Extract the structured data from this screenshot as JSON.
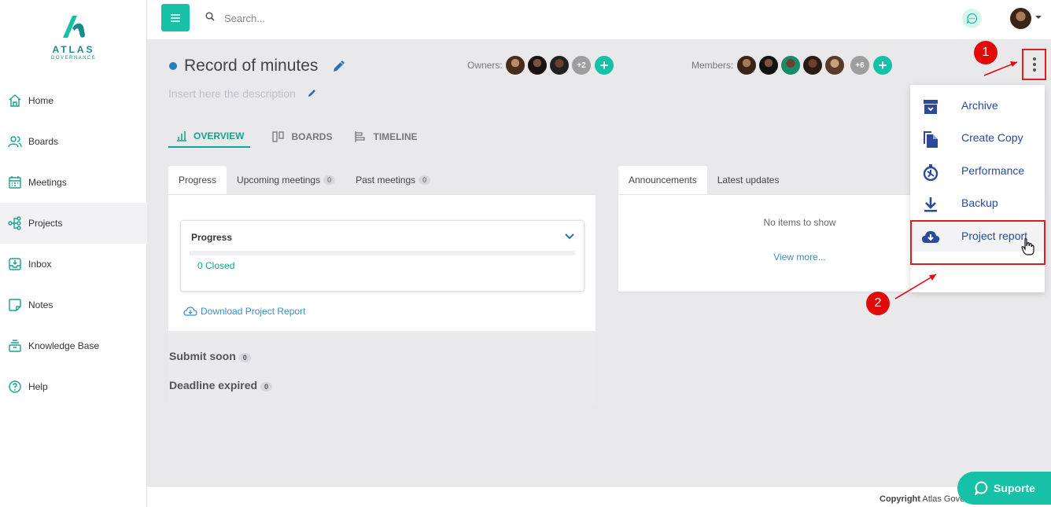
{
  "brand": {
    "name": "ATLAS",
    "tagline": "GOVERNANCE",
    "accent": "#17c1a8"
  },
  "sidebar": {
    "items": [
      {
        "label": "Home",
        "icon": "home-icon"
      },
      {
        "label": "Boards",
        "icon": "users-icon"
      },
      {
        "label": "Meetings",
        "icon": "calendar-icon"
      },
      {
        "label": "Projects",
        "icon": "project-tree-icon",
        "active": true
      },
      {
        "label": "Inbox",
        "icon": "inbox-icon"
      },
      {
        "label": "Notes",
        "icon": "note-icon"
      },
      {
        "label": "Knowledge Base",
        "icon": "layers-icon"
      },
      {
        "label": "Help",
        "icon": "help-circle-icon"
      }
    ]
  },
  "topbar": {
    "search_placeholder": "Search..."
  },
  "project": {
    "title": "Record of minutes",
    "description_placeholder": "Insert here the description",
    "owners_label": "Owners:",
    "owners_more": "+2",
    "members_label": "Members:",
    "members_more": "+6"
  },
  "view_tabs": {
    "overview": "OVERVIEW",
    "boards": "BOARDS",
    "timeline": "TIMELINE"
  },
  "left_panel": {
    "tabs": {
      "progress": "Progress",
      "upcoming": "Upcoming meetings",
      "upcoming_count": "0",
      "past": "Past meetings",
      "past_count": "0"
    },
    "card_title": "Progress",
    "closed_text": "0 Closed",
    "download_link": "Download Project Report",
    "submit_soon": "Submit soon",
    "submit_soon_count": "0",
    "deadline_expired": "Deadline expired",
    "deadline_expired_count": "0"
  },
  "right_panel": {
    "tabs": {
      "announcements": "Announcements",
      "latest": "Latest updates"
    },
    "empty_text": "No items to show",
    "view_more": "View more..."
  },
  "menu": {
    "items": [
      {
        "label": "Archive",
        "icon": "archive-icon"
      },
      {
        "label": "Create Copy",
        "icon": "copy-icon"
      },
      {
        "label": "Performance",
        "icon": "stopwatch-icon"
      },
      {
        "label": "Backup",
        "icon": "download-icon"
      },
      {
        "label": "Project report",
        "icon": "cloud-download-icon"
      }
    ]
  },
  "annotations": {
    "step1": "1",
    "step2": "2"
  },
  "footer": {
    "copyright_bold": "Copyright",
    "copyright_rest": " Atlas Governance 2021"
  },
  "support": {
    "label": "Suporte"
  }
}
